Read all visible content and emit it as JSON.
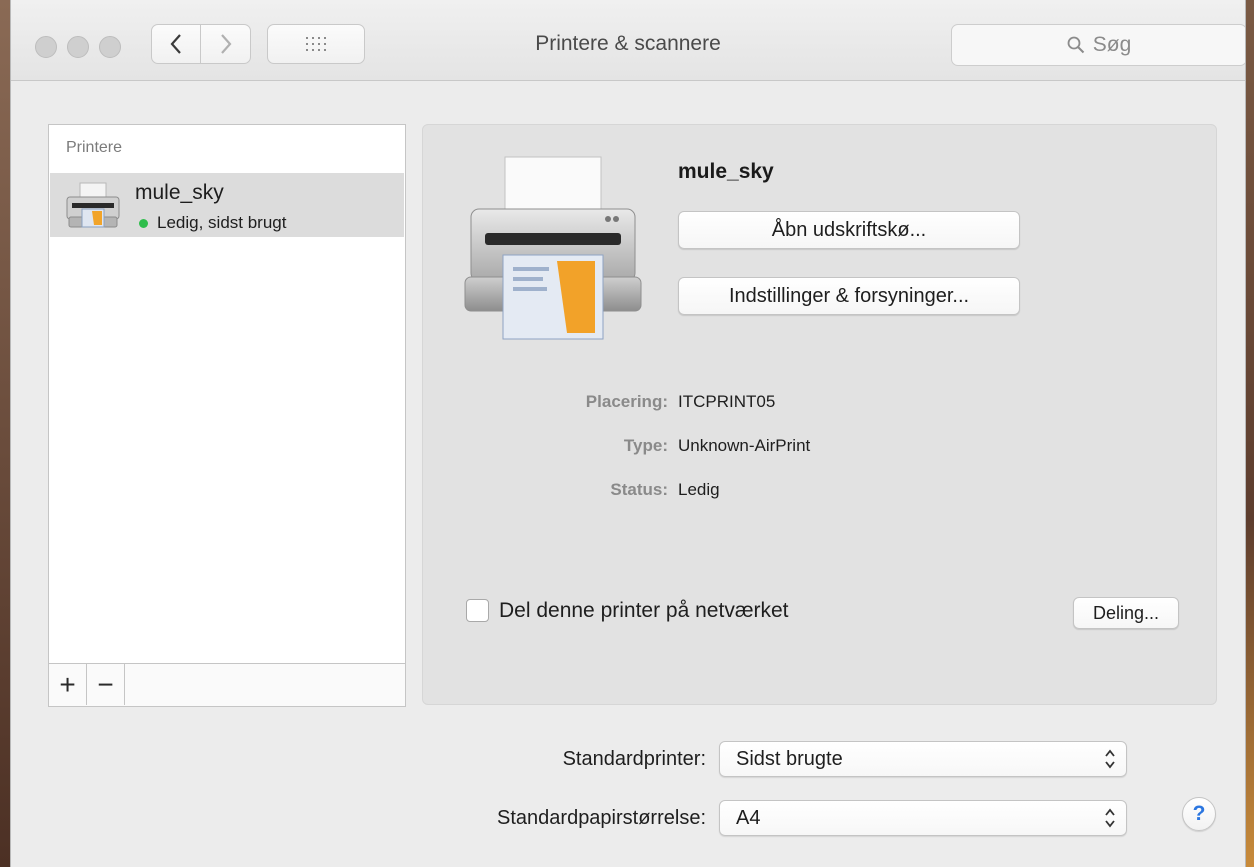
{
  "window": {
    "title": "Printere & scannere",
    "search_placeholder": "Søg"
  },
  "sidebar": {
    "header": "Printere",
    "printers": [
      {
        "name": "mule_sky",
        "status": "Ledig, sidst brugt",
        "status_color": "#2fbd4c"
      }
    ],
    "add_label": "+",
    "remove_label": "−"
  },
  "detail": {
    "name": "mule_sky",
    "open_queue_label": "Åbn udskriftskø...",
    "options_label": "Indstillinger & forsyninger...",
    "info": {
      "location_label": "Placering:",
      "location_value": "ITCPRINT05",
      "type_label": "Type:",
      "type_value": "Unknown-AirPrint",
      "status_label": "Status:",
      "status_value": "Ledig"
    },
    "share_label": "Del denne printer på netværket",
    "share_checked": false,
    "sharing_button_label": "Deling..."
  },
  "defaults": {
    "printer_label": "Standardprinter:",
    "printer_value": "Sidst brugte",
    "paper_label": "Standardpapirstørrelse:",
    "paper_value": "A4"
  },
  "help_label": "?",
  "colors": {
    "accent": "#2b76e0",
    "status_ok": "#2fbd4c"
  }
}
